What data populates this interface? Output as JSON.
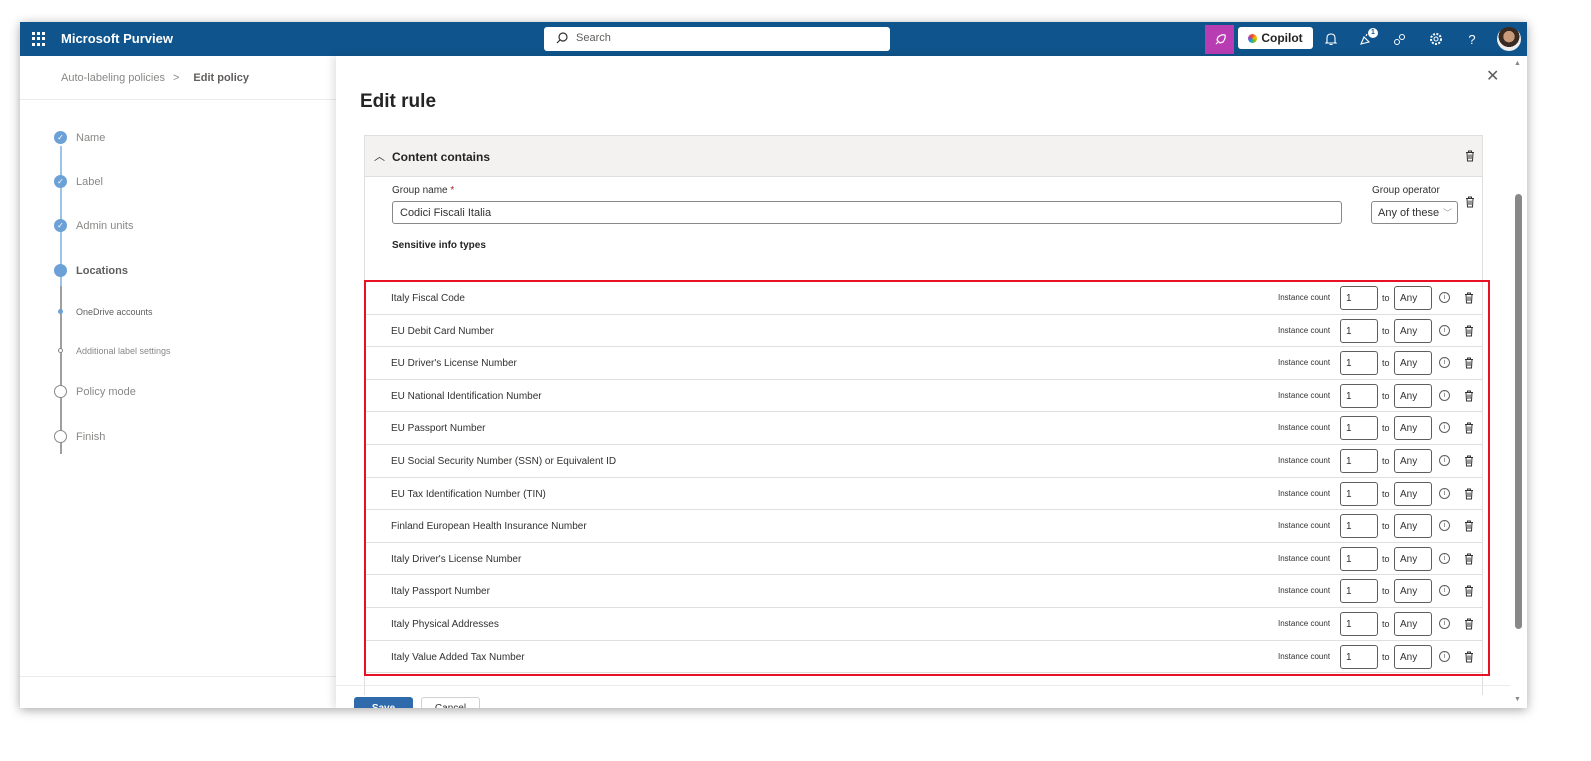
{
  "app": {
    "title": "Microsoft Purview",
    "search_placeholder": "Search",
    "copilot_label": "Copilot",
    "notification_count": "1",
    "help": "?"
  },
  "breadcrumb": {
    "parent": "Auto-labeling policies",
    "current": "Edit policy"
  },
  "steps": [
    {
      "label": "Name",
      "state": "done"
    },
    {
      "label": "Label",
      "state": "done"
    },
    {
      "label": "Admin units",
      "state": "done"
    },
    {
      "label": "Locations",
      "state": "current"
    },
    {
      "label": "OneDrive accounts",
      "state": "sub-current"
    },
    {
      "label": "Additional label settings",
      "state": "sub-todo"
    },
    {
      "label": "Policy mode",
      "state": "todo"
    },
    {
      "label": "Finish",
      "state": "todo"
    }
  ],
  "panel": {
    "title": "Edit rule",
    "section_title": "Content contains",
    "group_name_label": "Group name",
    "group_name_required": "*",
    "group_name_value": "Codici Fiscali Italia",
    "group_operator_label": "Group operator",
    "group_operator_value": "Any of these",
    "sit_label": "Sensitive info types",
    "instance_count_label": "Instance count",
    "to_label": "to",
    "info_types": [
      {
        "name": "Italy Fiscal Code",
        "min": "1",
        "max": "Any"
      },
      {
        "name": "EU Debit Card Number",
        "min": "1",
        "max": "Any"
      },
      {
        "name": "EU Driver's License Number",
        "min": "1",
        "max": "Any"
      },
      {
        "name": "EU National Identification Number",
        "min": "1",
        "max": "Any"
      },
      {
        "name": "EU Passport Number",
        "min": "1",
        "max": "Any"
      },
      {
        "name": "EU Social Security Number (SSN) or Equivalent ID",
        "min": "1",
        "max": "Any"
      },
      {
        "name": "EU Tax Identification Number (TIN)",
        "min": "1",
        "max": "Any"
      },
      {
        "name": "Finland European Health Insurance Number",
        "min": "1",
        "max": "Any"
      },
      {
        "name": "Italy Driver's License Number",
        "min": "1",
        "max": "Any"
      },
      {
        "name": "Italy Passport Number",
        "min": "1",
        "max": "Any"
      },
      {
        "name": "Italy Physical Addresses",
        "min": "1",
        "max": "Any"
      },
      {
        "name": "Italy Value Added Tax Number",
        "min": "1",
        "max": "Any"
      }
    ],
    "save_label": "Save",
    "cancel_label": "Cancel"
  },
  "colors": {
    "topbar": "#0f548c",
    "highlight": "#e81123",
    "primary": "#2f6aad",
    "copilot_tile": "#b83db3"
  }
}
